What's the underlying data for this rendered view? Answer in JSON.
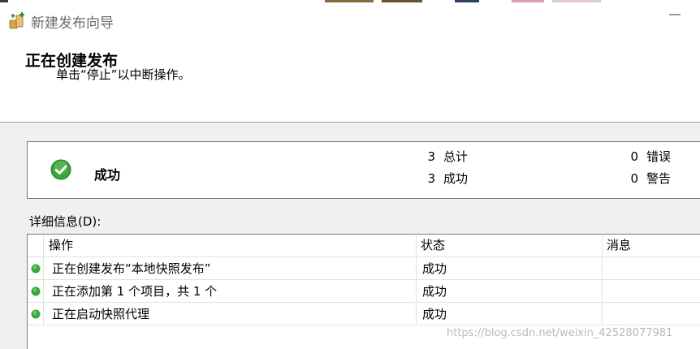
{
  "window": {
    "title": "新建发布向导"
  },
  "header": {
    "title": "正在创建发布",
    "subtitle": "单击“停止”以中断操作。"
  },
  "summary": {
    "status": "成功",
    "total_count": "3",
    "total_label": "总计",
    "success_count": "3",
    "success_label": "成功",
    "error_count": "0",
    "error_label": "错误",
    "warning_count": "0",
    "warning_label": "警告"
  },
  "details": {
    "label": "详细信息(D):",
    "columns": [
      "操作",
      "状态",
      "消息"
    ],
    "rows": [
      {
        "action": "正在创建发布“本地快照发布”",
        "status": "成功",
        "message": ""
      },
      {
        "action": "正在添加第 1 个项目，共 1 个",
        "status": "成功",
        "message": ""
      },
      {
        "action": "正在启动快照代理",
        "status": "成功",
        "message": ""
      }
    ]
  },
  "watermark": "https://blog.csdn.net/weixin_42528077981",
  "colors": {
    "success_green": "#3aa53a",
    "border": "#7a7a7a",
    "panel_bg": "#f0f0f0"
  },
  "icons": {
    "title": "wizard-icon",
    "status": "check-circle-icon",
    "row": "success-dot-icon"
  }
}
